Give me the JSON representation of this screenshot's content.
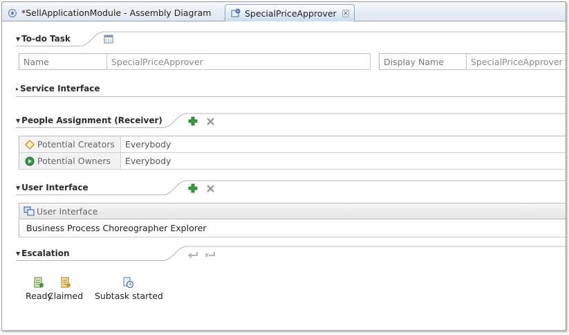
{
  "tabs": [
    {
      "label": "*SellApplicationModule - Assembly Diagram",
      "active": false
    },
    {
      "label": "SpecialPriceApprover",
      "active": true
    }
  ],
  "todo": {
    "title": "To-do Task",
    "name_label": "Name",
    "name_value": "SpecialPriceApprover",
    "display_label": "Display Name",
    "display_value": "SpecialPriceApprover"
  },
  "service_interface": {
    "title": "Service Interface"
  },
  "people": {
    "title": "People Assignment (Receiver)",
    "rows": [
      {
        "role": "Potential Creators",
        "value": "Everybody",
        "icon": "diamond-icon"
      },
      {
        "role": "Potential Owners",
        "value": "Everybody",
        "icon": "green-play-icon"
      }
    ]
  },
  "user_interface": {
    "title": "User Interface",
    "header": "User Interface",
    "row": "Business Process Choreographer Explorer"
  },
  "escalation": {
    "title": "Escalation",
    "states": [
      {
        "label": "Ready",
        "icon": "ready-state-icon"
      },
      {
        "label": "Claimed",
        "icon": "claimed-state-icon"
      },
      {
        "label": "Subtask started",
        "icon": "subtask-started-icon"
      }
    ]
  },
  "colors": {
    "accent_green": "#2e8b2e",
    "tab_active": "#c8dcf3",
    "border": "#b9b9b9"
  }
}
